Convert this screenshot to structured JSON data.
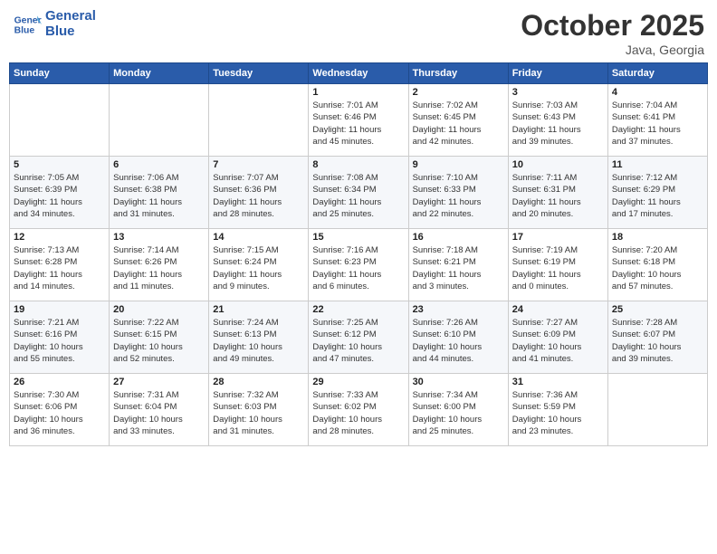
{
  "header": {
    "logo_line1": "General",
    "logo_line2": "Blue",
    "month_title": "October 2025",
    "location": "Java, Georgia"
  },
  "weekdays": [
    "Sunday",
    "Monday",
    "Tuesday",
    "Wednesday",
    "Thursday",
    "Friday",
    "Saturday"
  ],
  "weeks": [
    [
      {
        "day": "",
        "info": ""
      },
      {
        "day": "",
        "info": ""
      },
      {
        "day": "",
        "info": ""
      },
      {
        "day": "1",
        "info": "Sunrise: 7:01 AM\nSunset: 6:46 PM\nDaylight: 11 hours\nand 45 minutes."
      },
      {
        "day": "2",
        "info": "Sunrise: 7:02 AM\nSunset: 6:45 PM\nDaylight: 11 hours\nand 42 minutes."
      },
      {
        "day": "3",
        "info": "Sunrise: 7:03 AM\nSunset: 6:43 PM\nDaylight: 11 hours\nand 39 minutes."
      },
      {
        "day": "4",
        "info": "Sunrise: 7:04 AM\nSunset: 6:41 PM\nDaylight: 11 hours\nand 37 minutes."
      }
    ],
    [
      {
        "day": "5",
        "info": "Sunrise: 7:05 AM\nSunset: 6:39 PM\nDaylight: 11 hours\nand 34 minutes."
      },
      {
        "day": "6",
        "info": "Sunrise: 7:06 AM\nSunset: 6:38 PM\nDaylight: 11 hours\nand 31 minutes."
      },
      {
        "day": "7",
        "info": "Sunrise: 7:07 AM\nSunset: 6:36 PM\nDaylight: 11 hours\nand 28 minutes."
      },
      {
        "day": "8",
        "info": "Sunrise: 7:08 AM\nSunset: 6:34 PM\nDaylight: 11 hours\nand 25 minutes."
      },
      {
        "day": "9",
        "info": "Sunrise: 7:10 AM\nSunset: 6:33 PM\nDaylight: 11 hours\nand 22 minutes."
      },
      {
        "day": "10",
        "info": "Sunrise: 7:11 AM\nSunset: 6:31 PM\nDaylight: 11 hours\nand 20 minutes."
      },
      {
        "day": "11",
        "info": "Sunrise: 7:12 AM\nSunset: 6:29 PM\nDaylight: 11 hours\nand 17 minutes."
      }
    ],
    [
      {
        "day": "12",
        "info": "Sunrise: 7:13 AM\nSunset: 6:28 PM\nDaylight: 11 hours\nand 14 minutes."
      },
      {
        "day": "13",
        "info": "Sunrise: 7:14 AM\nSunset: 6:26 PM\nDaylight: 11 hours\nand 11 minutes."
      },
      {
        "day": "14",
        "info": "Sunrise: 7:15 AM\nSunset: 6:24 PM\nDaylight: 11 hours\nand 9 minutes."
      },
      {
        "day": "15",
        "info": "Sunrise: 7:16 AM\nSunset: 6:23 PM\nDaylight: 11 hours\nand 6 minutes."
      },
      {
        "day": "16",
        "info": "Sunrise: 7:18 AM\nSunset: 6:21 PM\nDaylight: 11 hours\nand 3 minutes."
      },
      {
        "day": "17",
        "info": "Sunrise: 7:19 AM\nSunset: 6:19 PM\nDaylight: 11 hours\nand 0 minutes."
      },
      {
        "day": "18",
        "info": "Sunrise: 7:20 AM\nSunset: 6:18 PM\nDaylight: 10 hours\nand 57 minutes."
      }
    ],
    [
      {
        "day": "19",
        "info": "Sunrise: 7:21 AM\nSunset: 6:16 PM\nDaylight: 10 hours\nand 55 minutes."
      },
      {
        "day": "20",
        "info": "Sunrise: 7:22 AM\nSunset: 6:15 PM\nDaylight: 10 hours\nand 52 minutes."
      },
      {
        "day": "21",
        "info": "Sunrise: 7:24 AM\nSunset: 6:13 PM\nDaylight: 10 hours\nand 49 minutes."
      },
      {
        "day": "22",
        "info": "Sunrise: 7:25 AM\nSunset: 6:12 PM\nDaylight: 10 hours\nand 47 minutes."
      },
      {
        "day": "23",
        "info": "Sunrise: 7:26 AM\nSunset: 6:10 PM\nDaylight: 10 hours\nand 44 minutes."
      },
      {
        "day": "24",
        "info": "Sunrise: 7:27 AM\nSunset: 6:09 PM\nDaylight: 10 hours\nand 41 minutes."
      },
      {
        "day": "25",
        "info": "Sunrise: 7:28 AM\nSunset: 6:07 PM\nDaylight: 10 hours\nand 39 minutes."
      }
    ],
    [
      {
        "day": "26",
        "info": "Sunrise: 7:30 AM\nSunset: 6:06 PM\nDaylight: 10 hours\nand 36 minutes."
      },
      {
        "day": "27",
        "info": "Sunrise: 7:31 AM\nSunset: 6:04 PM\nDaylight: 10 hours\nand 33 minutes."
      },
      {
        "day": "28",
        "info": "Sunrise: 7:32 AM\nSunset: 6:03 PM\nDaylight: 10 hours\nand 31 minutes."
      },
      {
        "day": "29",
        "info": "Sunrise: 7:33 AM\nSunset: 6:02 PM\nDaylight: 10 hours\nand 28 minutes."
      },
      {
        "day": "30",
        "info": "Sunrise: 7:34 AM\nSunset: 6:00 PM\nDaylight: 10 hours\nand 25 minutes."
      },
      {
        "day": "31",
        "info": "Sunrise: 7:36 AM\nSunset: 5:59 PM\nDaylight: 10 hours\nand 23 minutes."
      },
      {
        "day": "",
        "info": ""
      }
    ]
  ]
}
